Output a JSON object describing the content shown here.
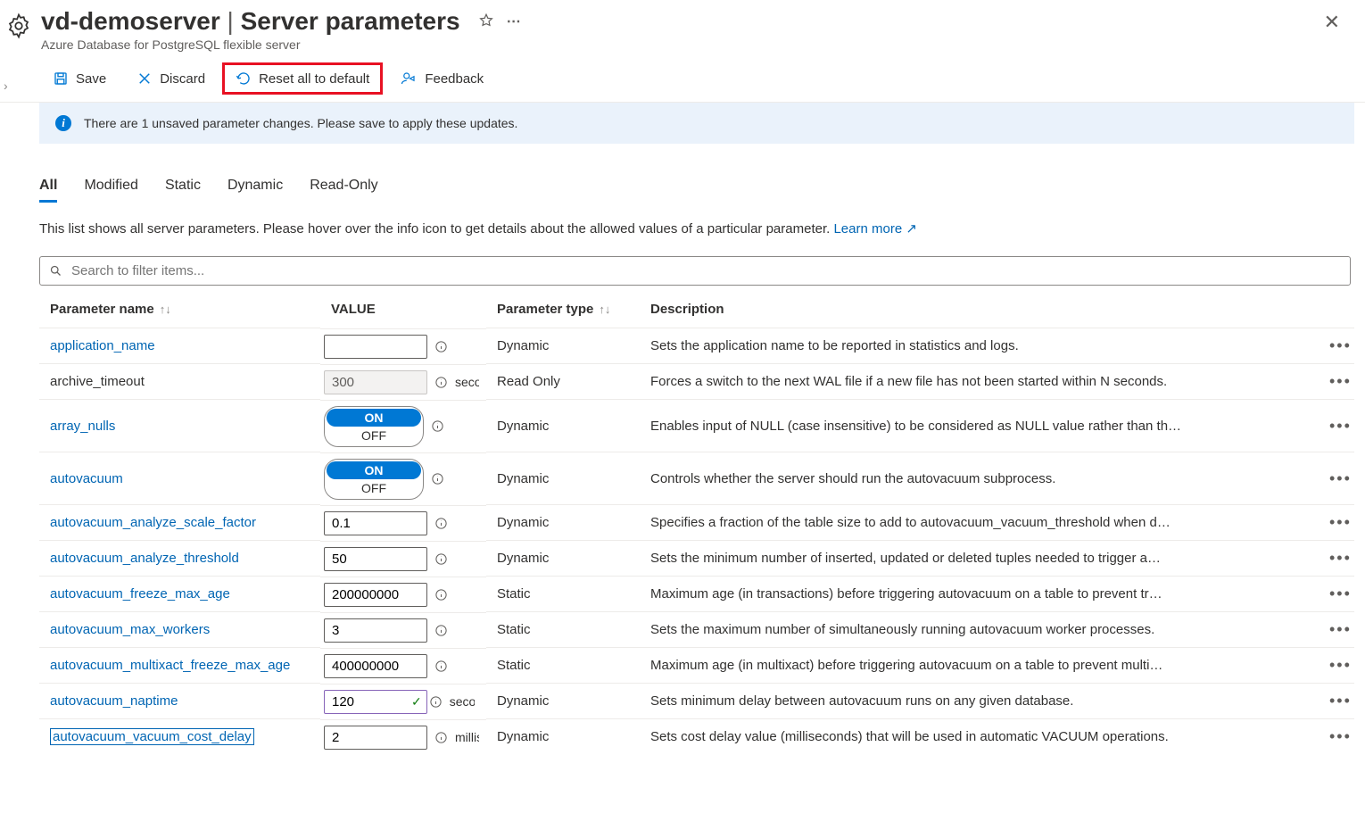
{
  "header": {
    "resource": "vd-demoserver",
    "section": "Server parameters",
    "subtitle": "Azure Database for PostgreSQL flexible server"
  },
  "toolbar": {
    "save": "Save",
    "discard": "Discard",
    "reset": "Reset all to default",
    "feedback": "Feedback"
  },
  "infobar": "There are 1 unsaved parameter changes.  Please save to apply these updates.",
  "tabs": [
    "All",
    "Modified",
    "Static",
    "Dynamic",
    "Read-Only"
  ],
  "active_tab": 0,
  "description": "This list shows all server parameters. Please hover over the info icon to get details about the allowed values of a particular parameter. ",
  "learn_more": "Learn more",
  "search_placeholder": "Search to filter items...",
  "columns": {
    "name": "Parameter name",
    "value": "VALUE",
    "type": "Parameter type",
    "desc": "Description"
  },
  "rows": [
    {
      "name": "application_name",
      "link": true,
      "value_type": "text",
      "value": "",
      "unit": "",
      "ptype": "Dynamic",
      "desc": "Sets the application name to be reported in statistics and logs."
    },
    {
      "name": "archive_timeout",
      "link": false,
      "value_type": "readonly",
      "value": "300",
      "unit": "seconds",
      "ptype": "Read Only",
      "desc": "Forces a switch to the next WAL file if a new file has not been started within N seconds."
    },
    {
      "name": "array_nulls",
      "link": true,
      "value_type": "toggle",
      "value": "ON",
      "ptype": "Dynamic",
      "desc": "Enables input of NULL (case insensitive) to be considered as NULL value rather than th…"
    },
    {
      "name": "autovacuum",
      "link": true,
      "value_type": "toggle",
      "value": "ON",
      "ptype": "Dynamic",
      "desc": "Controls whether the server should run the autovacuum subprocess."
    },
    {
      "name": "autovacuum_analyze_scale_factor",
      "link": true,
      "value_type": "text",
      "value": "0.1",
      "unit": "",
      "ptype": "Dynamic",
      "desc": "Specifies a fraction of the table size to add to autovacuum_vacuum_threshold when d…"
    },
    {
      "name": "autovacuum_analyze_threshold",
      "link": true,
      "value_type": "text",
      "value": "50",
      "unit": "",
      "ptype": "Dynamic",
      "desc": "Sets the minimum number of inserted, updated or deleted tuples needed to trigger a…"
    },
    {
      "name": "autovacuum_freeze_max_age",
      "link": true,
      "value_type": "text",
      "value": "200000000",
      "unit": "",
      "ptype": "Static",
      "desc": "Maximum age (in transactions) before triggering autovacuum on a table to prevent tr…"
    },
    {
      "name": "autovacuum_max_workers",
      "link": true,
      "value_type": "text",
      "value": "3",
      "unit": "",
      "ptype": "Static",
      "desc": "Sets the maximum number of simultaneously running autovacuum worker processes."
    },
    {
      "name": "autovacuum_multixact_freeze_max_age",
      "link": true,
      "value_type": "text",
      "value": "400000000",
      "unit": "",
      "ptype": "Static",
      "desc": "Maximum age (in multixact) before triggering autovacuum on a table to prevent multi…"
    },
    {
      "name": "autovacuum_naptime",
      "link": true,
      "value_type": "modified",
      "value": "120",
      "unit": "seconds",
      "ptype": "Dynamic",
      "desc": "Sets minimum delay between autovacuum runs on any given database."
    },
    {
      "name": "autovacuum_vacuum_cost_delay",
      "link": true,
      "selected": true,
      "value_type": "text",
      "value": "2",
      "unit": "milliseconds",
      "ptype": "Dynamic",
      "desc": "Sets cost delay value (milliseconds) that will be used in automatic VACUUM operations."
    }
  ]
}
